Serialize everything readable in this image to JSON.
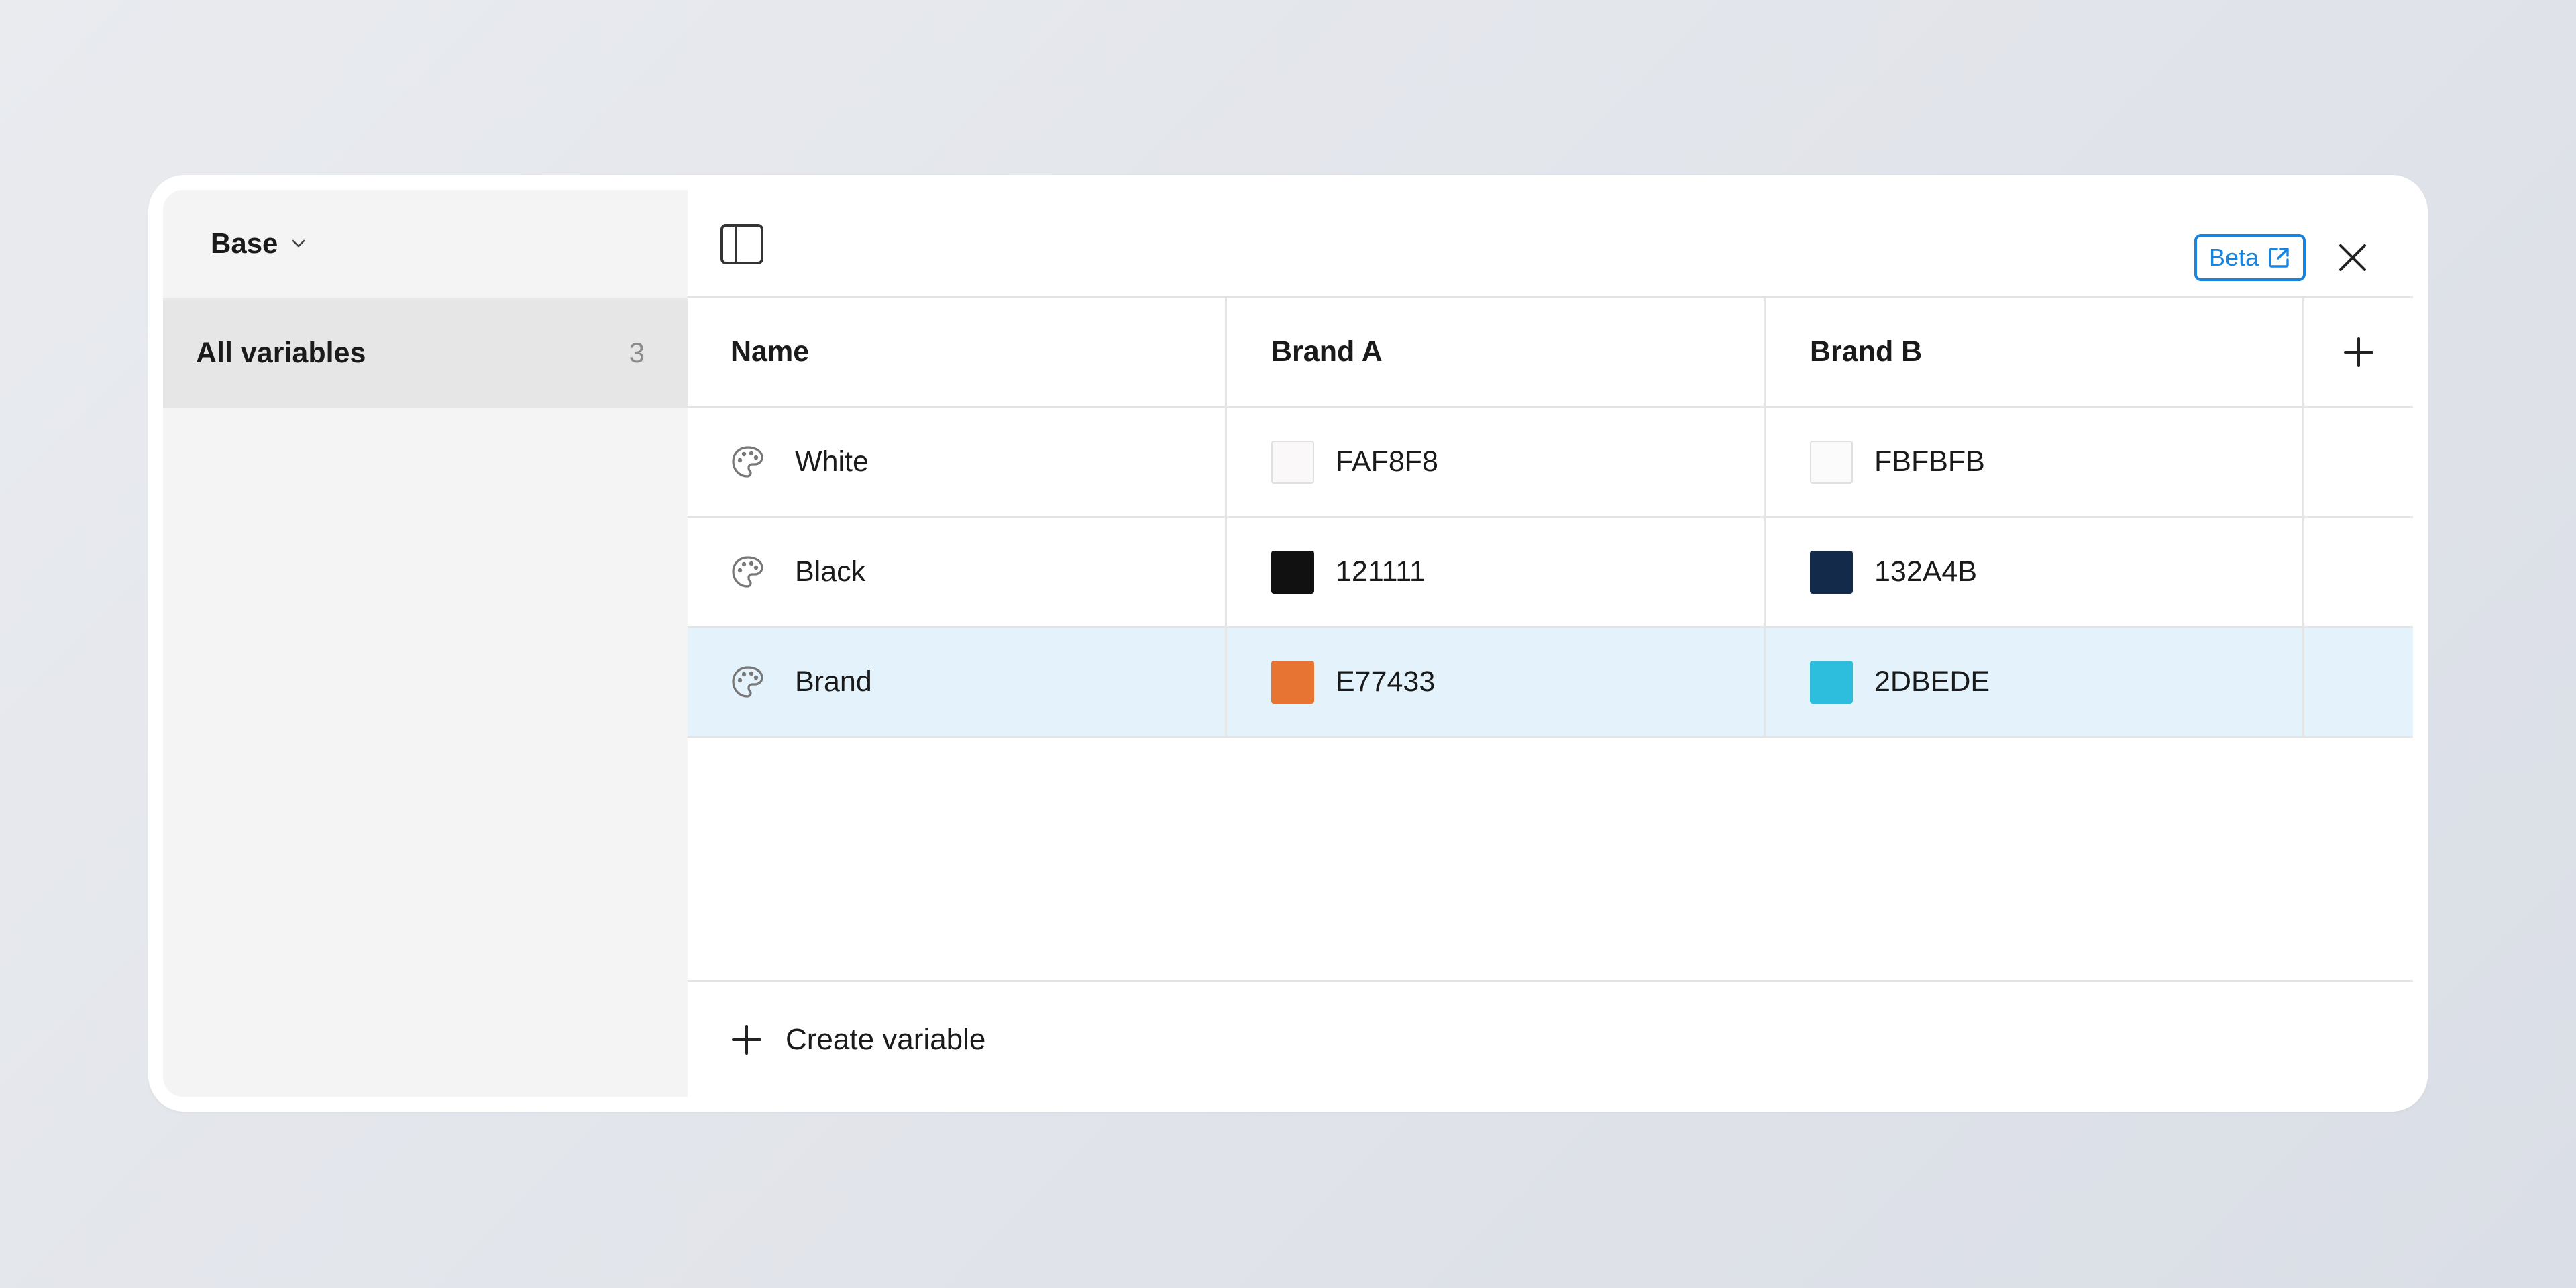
{
  "sidebar": {
    "collection_name": "Base",
    "items": [
      {
        "label": "All variables",
        "count": "3"
      }
    ]
  },
  "toolbar": {
    "beta_label": "Beta"
  },
  "table": {
    "columns": [
      "Name",
      "Brand A",
      "Brand B"
    ],
    "rows": [
      {
        "name": "White",
        "brand_a": "FAF8F8",
        "brand_a_color": "#FAF8F8",
        "brand_b": "FBFBFB",
        "brand_b_color": "#FBFBFB"
      },
      {
        "name": "Black",
        "brand_a": "121111",
        "brand_a_color": "#121111",
        "brand_b": "132A4B",
        "brand_b_color": "#132A4B"
      },
      {
        "name": "Brand",
        "brand_a": "E77433",
        "brand_a_color": "#E77433",
        "brand_b": "2DBEDE",
        "brand_b_color": "#2DBEDE"
      }
    ],
    "selected_row": "Brand"
  },
  "footer": {
    "create_label": "Create variable"
  },
  "colors": {
    "accent": "#1784E0",
    "selected_row_bg": "#E4F2FC",
    "sidebar_bg": "#F4F4F4"
  },
  "icons": {
    "chevron": "chevron-down-icon",
    "sidebar_toggle": "sidebar-toggle-icon",
    "external": "external-link-icon",
    "close": "close-icon",
    "variable_type": "palette-icon",
    "add": "plus-icon"
  }
}
